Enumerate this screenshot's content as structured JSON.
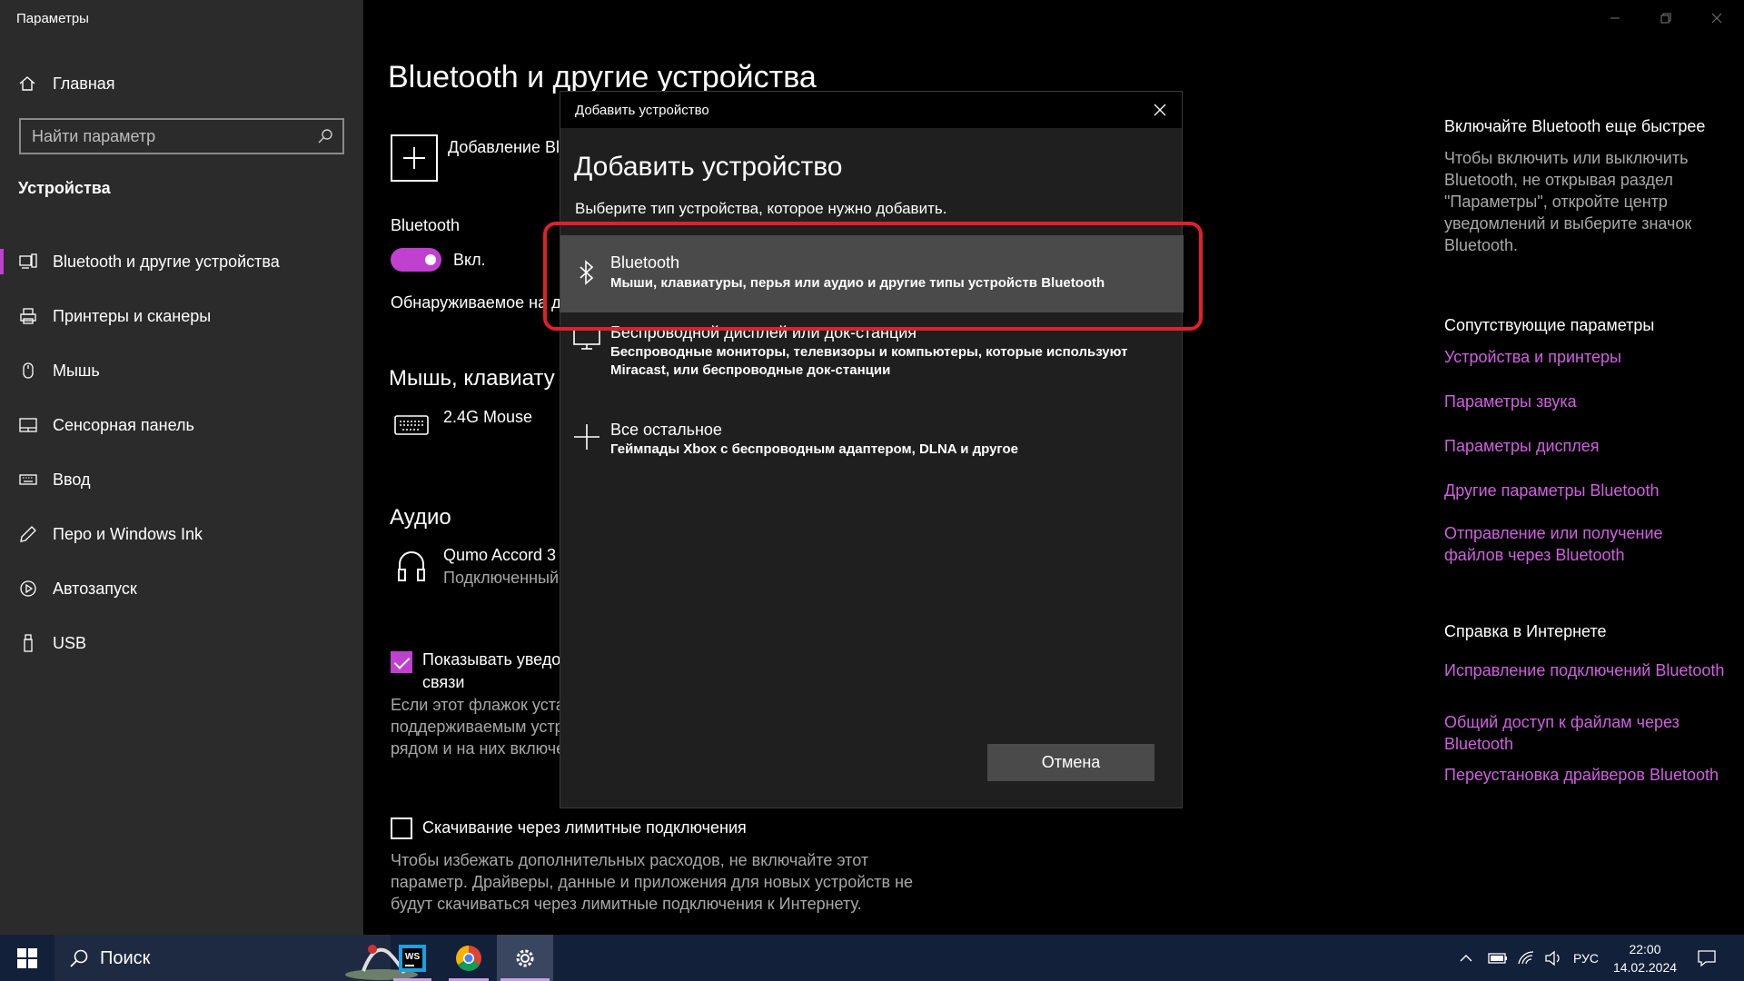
{
  "window": {
    "title": "Параметры"
  },
  "sidebar": {
    "home_label": "Главная",
    "search_placeholder": "Найти параметр",
    "section_title": "Устройства",
    "items": [
      {
        "label": "Bluetooth и другие устройства",
        "icon": "bluetooth-devices-icon",
        "active": true
      },
      {
        "label": "Принтеры и сканеры",
        "icon": "printer-icon"
      },
      {
        "label": "Мышь",
        "icon": "mouse-icon"
      },
      {
        "label": "Сенсорная панель",
        "icon": "touchpad-icon"
      },
      {
        "label": "Ввод",
        "icon": "keyboard-icon"
      },
      {
        "label": "Перо и Windows Ink",
        "icon": "pen-icon"
      },
      {
        "label": "Автозапуск",
        "icon": "autoplay-icon"
      },
      {
        "label": "USB",
        "icon": "usb-icon"
      }
    ]
  },
  "main": {
    "title": "Bluetooth и другие устройства",
    "add_device_label": "Добавление Blu",
    "bluetooth_label": "Bluetooth",
    "toggle_state": "Вкл.",
    "discoverable_text": "Обнаруживаемое на да",
    "mouse_section": "Мышь, клавиату",
    "mouse_device": "2.4G Mouse",
    "audio_section": "Аудио",
    "audio_device": "Qumo Accord 3",
    "audio_status": "Подключенный",
    "notify_checkbox_label_1": "Показывать уведом",
    "notify_checkbox_label_2": "связи",
    "notify_desc": [
      "Если этот флажок устан",
      "поддерживаемым устр",
      "рядом и на них включе"
    ],
    "metered_label": "Скачивание через лимитные подключения",
    "metered_desc": [
      "Чтобы избежать дополнительных расходов, не включайте этот",
      "параметр. Драйверы, данные и приложения для новых устройств не",
      "будут скачиваться через лимитные подключения к Интернету."
    ]
  },
  "right": {
    "tip_title": "Включайте Bluetooth еще быстрее",
    "tip_text": "Чтобы включить или выключить Bluetooth, не открывая раздел \"Параметры\", откройте центр уведомлений и выберите значок Bluetooth.",
    "related_title": "Сопутствующие параметры",
    "related_links": [
      "Устройства и принтеры",
      "Параметры звука",
      "Параметры дисплея",
      "Другие параметры Bluetooth",
      "Отправление или получение файлов через Bluetooth"
    ],
    "help_title": "Справка в Интернете",
    "help_links": [
      "Исправление подключений Bluetooth",
      "Общий доступ к файлам через Bluetooth",
      "Переустановка драйверов Bluetooth"
    ]
  },
  "dialog": {
    "titlebar": "Добавить устройство",
    "heading": "Добавить устройство",
    "subtitle": "Выберите тип устройства, которое нужно добавить.",
    "options": [
      {
        "title": "Bluetooth",
        "desc": "Мыши, клавиатуры, перья или аудио и другие типы устройств Bluetooth",
        "icon": "bluetooth-icon",
        "selected": true
      },
      {
        "title": "Беспроводной дисплей или док-станция",
        "desc": "Беспроводные мониторы, телевизоры и компьютеры, которые используют Miracast, или беспроводные док-станции",
        "icon": "monitor-icon"
      },
      {
        "title": "Все остальное",
        "desc": "Геймпады Xbox с беспроводным адаптером, DLNA и другое",
        "icon": "plus-icon"
      }
    ],
    "cancel_label": "Отмена"
  },
  "taskbar": {
    "search_label": "Поиск",
    "apps": [
      "webstorm-icon",
      "chrome-icon",
      "settings-icon"
    ],
    "language": "РУС",
    "time": "22:00",
    "date": "14.02.2024"
  },
  "colors": {
    "accent": "#c040d0",
    "link": "#d060e0",
    "highlight": "#e0202a"
  }
}
